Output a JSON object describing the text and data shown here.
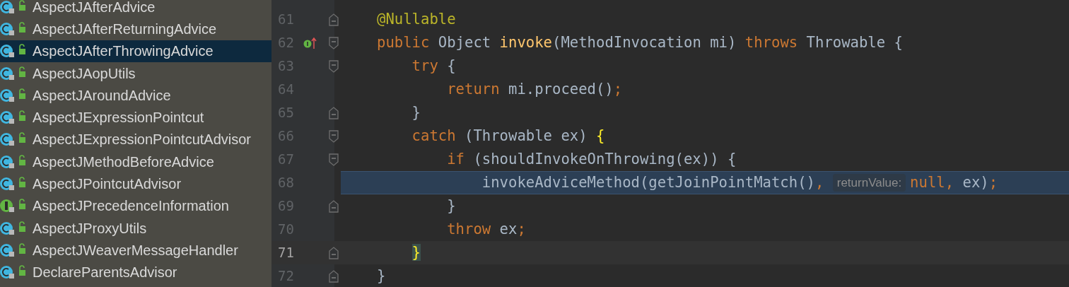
{
  "project_tree": {
    "items": [
      {
        "name": "AspectJAfterAdvice",
        "kind": "class",
        "selected": false
      },
      {
        "name": "AspectJAfterReturningAdvice",
        "kind": "class",
        "selected": false
      },
      {
        "name": "AspectJAfterThrowingAdvice",
        "kind": "class",
        "selected": true
      },
      {
        "name": "AspectJAopUtils",
        "kind": "class",
        "selected": false
      },
      {
        "name": "AspectJAroundAdvice",
        "kind": "class",
        "selected": false
      },
      {
        "name": "AspectJExpressionPointcut",
        "kind": "class",
        "selected": false
      },
      {
        "name": "AspectJExpressionPointcutAdvisor",
        "kind": "class",
        "selected": false
      },
      {
        "name": "AspectJMethodBeforeAdvice",
        "kind": "class",
        "selected": false
      },
      {
        "name": "AspectJPointcutAdvisor",
        "kind": "class",
        "selected": false
      },
      {
        "name": "AspectJPrecedenceInformation",
        "kind": "interface",
        "selected": false
      },
      {
        "name": "AspectJProxyUtils",
        "kind": "class",
        "selected": false
      },
      {
        "name": "AspectJWeaverMessageHandler",
        "kind": "class",
        "selected": false
      },
      {
        "name": "DeclareParentsAdvisor",
        "kind": "class",
        "selected": false
      }
    ]
  },
  "editor": {
    "lines": [
      {
        "number": "61",
        "kind": "end",
        "override": false,
        "selected": false,
        "current": false,
        "tokens": [
          {
            "kind": "annotation",
            "text": "@Nullable"
          }
        ]
      },
      {
        "number": "62",
        "kind": "start",
        "override": true,
        "selected": false,
        "current": false,
        "tokens": [
          {
            "kind": "keyword",
            "text": "public "
          },
          {
            "kind": "plain",
            "text": "Object "
          },
          {
            "kind": "method",
            "text": "invoke"
          },
          {
            "kind": "plain",
            "text": "(MethodInvocation mi) "
          },
          {
            "kind": "keyword",
            "text": "throws "
          },
          {
            "kind": "plain",
            "text": "Throwable {"
          }
        ]
      },
      {
        "number": "63",
        "kind": "start",
        "override": false,
        "selected": false,
        "current": false,
        "tokens": [
          {
            "kind": "keyword",
            "text": "    try "
          },
          {
            "kind": "plain",
            "text": "{"
          }
        ]
      },
      {
        "number": "64",
        "kind": "none",
        "override": false,
        "selected": false,
        "current": false,
        "tokens": [
          {
            "kind": "keyword",
            "text": "        return "
          },
          {
            "kind": "plain",
            "text": "mi.proceed()"
          },
          {
            "kind": "keyword",
            "text": ";"
          }
        ]
      },
      {
        "number": "65",
        "kind": "end",
        "override": false,
        "selected": false,
        "current": false,
        "tokens": [
          {
            "kind": "plain",
            "text": "    }"
          }
        ]
      },
      {
        "number": "66",
        "kind": "start",
        "override": false,
        "selected": false,
        "current": false,
        "tokens": [
          {
            "kind": "keyword",
            "text": "    catch "
          },
          {
            "kind": "plain",
            "text": "(Throwable ex) "
          },
          {
            "kind": "brace",
            "text": "{"
          }
        ]
      },
      {
        "number": "67",
        "kind": "start",
        "override": false,
        "selected": false,
        "current": false,
        "tokens": [
          {
            "kind": "keyword",
            "text": "        if "
          },
          {
            "kind": "plain",
            "text": "(shouldInvokeOnThrowing(ex)) {"
          }
        ]
      },
      {
        "number": "68",
        "kind": "none",
        "override": false,
        "selected": true,
        "current": false,
        "tokens": [
          {
            "kind": "plain",
            "text": "            invokeAdviceMethod(getJoinPointMatch()"
          },
          {
            "kind": "keyword",
            "text": ", "
          },
          {
            "kind": "hint",
            "text": "returnValue:"
          },
          {
            "kind": "keyword",
            "text": "null, "
          },
          {
            "kind": "plain",
            "text": "ex)"
          },
          {
            "kind": "keyword",
            "text": ";"
          }
        ]
      },
      {
        "number": "69",
        "kind": "end",
        "override": false,
        "selected": false,
        "current": false,
        "tokens": [
          {
            "kind": "plain",
            "text": "        }"
          }
        ]
      },
      {
        "number": "70",
        "kind": "none",
        "override": false,
        "selected": false,
        "current": false,
        "tokens": [
          {
            "kind": "keyword",
            "text": "        throw "
          },
          {
            "kind": "plain",
            "text": "ex"
          },
          {
            "kind": "keyword",
            "text": ";"
          }
        ]
      },
      {
        "number": "71",
        "kind": "end",
        "override": false,
        "selected": false,
        "current": true,
        "tokens": [
          {
            "kind": "brace_match",
            "text": "    }"
          }
        ]
      },
      {
        "number": "72",
        "kind": "end",
        "override": false,
        "selected": false,
        "current": false,
        "tokens": [
          {
            "kind": "plain",
            "text": "}"
          }
        ]
      }
    ]
  }
}
